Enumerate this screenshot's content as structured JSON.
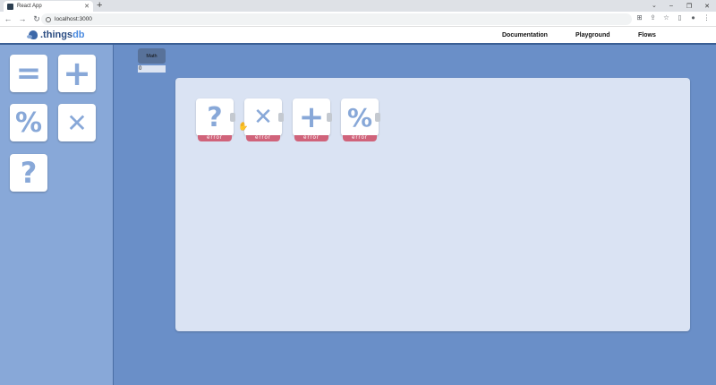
{
  "browser": {
    "tab_title": "React App",
    "tab_close": "✕",
    "new_tab": "+",
    "tab_dropdown": "⌄",
    "url": "localhost:3000",
    "nav": {
      "back": "←",
      "forward": "→",
      "reload": "↻"
    },
    "window_controls": {
      "minimize": "–",
      "maximize": "❐",
      "close": "✕"
    },
    "toolbar_icons": {
      "translate": "⊞",
      "share": "⇪",
      "bookmark": "☆",
      "sidepanel": "▯",
      "profile": "●",
      "menu": "⋮"
    }
  },
  "header": {
    "logo_prefix": ".things",
    "logo_suffix": "db",
    "nav": [
      "Documentation",
      "Playground",
      "Flows"
    ]
  },
  "sidebar": {
    "cards": [
      {
        "symbol": "=",
        "icon": "equals-icon"
      },
      {
        "symbol": "+",
        "icon": "plus-icon"
      },
      {
        "symbol": "%",
        "icon": "percent-icon"
      },
      {
        "symbol": "✕",
        "icon": "multiply-icon"
      },
      {
        "symbol": "?",
        "icon": "question-icon"
      }
    ]
  },
  "math_block": {
    "label": "Math",
    "value": "0"
  },
  "canvas": {
    "nodes": [
      {
        "symbol": "?",
        "icon": "question-icon",
        "status": "error"
      },
      {
        "symbol": "✕",
        "icon": "multiply-icon",
        "status": "error"
      },
      {
        "symbol": "+",
        "icon": "plus-icon",
        "status": "error"
      },
      {
        "symbol": "%",
        "icon": "percent-icon",
        "status": "error"
      }
    ]
  },
  "colors": {
    "background": "#6a8fc8",
    "sidebar": "#88a8d8",
    "canvas": "#dae3f3",
    "error": "#d0637a",
    "icon": "#88a8d8"
  }
}
